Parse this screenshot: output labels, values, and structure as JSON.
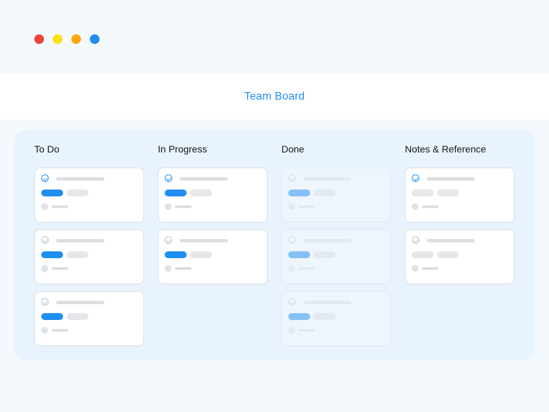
{
  "window_controls": [
    {
      "name": "red",
      "color": "#f04438"
    },
    {
      "name": "yellow",
      "color": "#fde010"
    },
    {
      "name": "orange",
      "color": "#fba80f"
    },
    {
      "name": "blue",
      "color": "#1f8ef1"
    }
  ],
  "header": {
    "title": "Team Board",
    "title_color": "#1f8ef1"
  },
  "colors": {
    "primary_tag": "#1f8ef1",
    "faded_tag": "#84c1f7",
    "neutral_tag": "#e5e7ea"
  },
  "columns": [
    {
      "id": "todo",
      "title": "To Do",
      "cards": [
        {
          "checked": true,
          "tag": "primary",
          "faded": false
        },
        {
          "checked": false,
          "tag": "primary",
          "faded": false
        },
        {
          "checked": false,
          "tag": "primary",
          "faded": false
        }
      ]
    },
    {
      "id": "in-progress",
      "title": "In Progress",
      "cards": [
        {
          "checked": true,
          "tag": "primary",
          "faded": false
        },
        {
          "checked": false,
          "tag": "primary",
          "faded": false
        }
      ]
    },
    {
      "id": "done",
      "title": "Done",
      "cards": [
        {
          "checked": true,
          "tag": "faded",
          "faded": true
        },
        {
          "checked": false,
          "tag": "faded",
          "faded": true
        },
        {
          "checked": false,
          "tag": "faded",
          "faded": true
        }
      ]
    },
    {
      "id": "notes-reference",
      "title": "Notes & Reference",
      "cards": [
        {
          "checked": true,
          "tag": "neutral",
          "faded": false
        },
        {
          "checked": false,
          "tag": "neutral",
          "faded": false
        }
      ]
    }
  ]
}
